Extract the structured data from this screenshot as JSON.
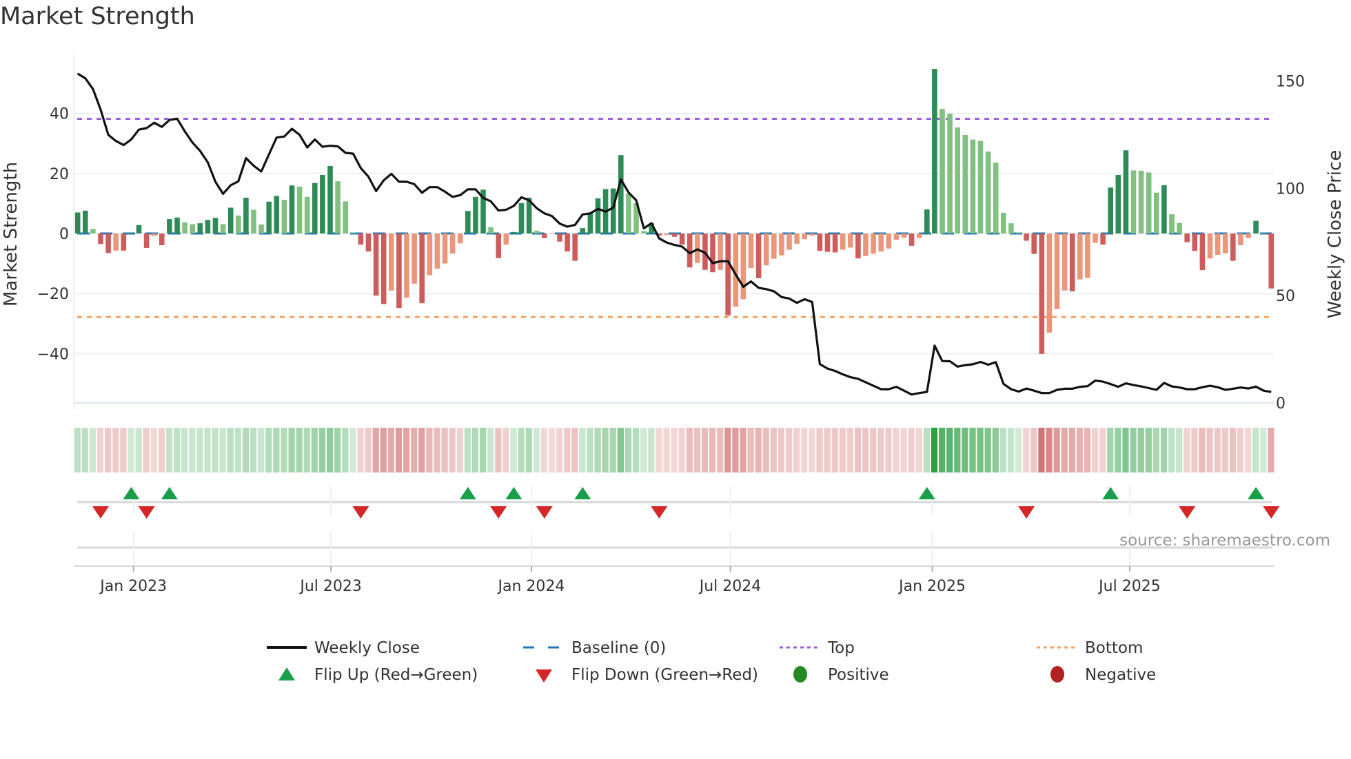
{
  "title": "Market Strength",
  "source": "source: sharemaestro.com",
  "colors": {
    "rise_green": "#2e8b57",
    "fall_green": "#81c07f",
    "fall_red": "#cd5c5c",
    "rise_red": "#e9967a",
    "close": "#111111",
    "baseline": "#1f77b4",
    "top": "#9b5fe0",
    "bottom": "#f4a261",
    "flip_up": "#1a9e4a",
    "flip_down": "#d62728",
    "positive": "#228b22",
    "negative": "#b22222"
  },
  "legend": {
    "weekly_close": "Weekly Close",
    "baseline": "Baseline (0)",
    "top": "Top",
    "bottom": "Bottom",
    "flip_up": "Flip Up (Red→Green)",
    "flip_down": "Flip Down (Green→Red)",
    "positive": "Positive",
    "negative": "Negative"
  },
  "chart_data": {
    "type": "bar",
    "title": "Market Strength",
    "ylabel": "Market Strength",
    "y2label": "Weekly Close Price",
    "x_unit": "week index",
    "ylim": [
      -57,
      59
    ],
    "y2lim": [
      0,
      160
    ],
    "yticks": [
      -40,
      -20,
      0,
      20,
      40
    ],
    "yticklabels": [
      "−40",
      "−20",
      "0",
      "20",
      "40"
    ],
    "y2ticks": [
      0,
      50,
      100,
      150
    ],
    "y2ticklabels": [
      "0",
      "50",
      "100",
      "150"
    ],
    "xticks": [
      7.3,
      33.1,
      59.3,
      85.3,
      111.7,
      137.5
    ],
    "xticklabels": [
      "Jan 2023",
      "Jul 2023",
      "Jan 2024",
      "Jul 2024",
      "Jan 2025",
      "Jul 2025"
    ],
    "top_level": 38.2,
    "bottom_level": -27.8,
    "baseline": 0,
    "strength": [
      7,
      7.6,
      1.5,
      -3.5,
      -6.5,
      -5.7,
      -5.7,
      0.3,
      2.8,
      -4.8,
      -0.8,
      -3.9,
      4.8,
      5.3,
      3.7,
      3.1,
      3.4,
      4.5,
      5.2,
      3.1,
      8.6,
      6,
      11.9,
      7.9,
      3,
      10.6,
      12.5,
      11.2,
      16,
      15.6,
      12.2,
      16.8,
      19.5,
      22.5,
      17.4,
      10.7,
      0.3,
      -3.7,
      -6,
      -20.7,
      -23.5,
      -19,
      -24.8,
      -21.4,
      -16.7,
      -23.2,
      -13.9,
      -11.7,
      -10,
      -6.7,
      -3.3,
      7.5,
      12.2,
      14.6,
      2.1,
      -8.2,
      -3.7,
      0.5,
      10.1,
      11.9,
      0.9,
      -1.5,
      -0.2,
      -2.7,
      -6,
      -9.1,
      1.8,
      6.7,
      11.7,
      14.8,
      15,
      26.1,
      13.3,
      10.1,
      0.8,
      3.4,
      -0.7,
      -0.5,
      -1.1,
      -3.7,
      -11.3,
      -9.8,
      -12.1,
      -12.9,
      -12.1,
      -27.3,
      -24.4,
      -21.9,
      -11.5,
      -14.9,
      -10.6,
      -8.4,
      -7.3,
      -5.4,
      -3.4,
      -1.9,
      -0.7,
      -5.8,
      -6.1,
      -6.3,
      -5.4,
      -4.7,
      -8.3,
      -7.5,
      -6.7,
      -6,
      -5,
      -2.1,
      -1.4,
      -4.1,
      -1.5,
      8,
      54.8,
      41.5,
      39.9,
      35.3,
      32.8,
      31.3,
      30.8,
      27.3,
      23.6,
      6.9,
      3.4,
      0.3,
      -2.4,
      -6.8,
      -40.1,
      -33,
      -25.2,
      -19,
      -19.3,
      -15.3,
      -14.8,
      -3.1,
      -3.7,
      15.3,
      19.5,
      27.7,
      21,
      20.9,
      20.3,
      13.6,
      16.1,
      6.4,
      3.5,
      -2.9,
      -5.8,
      -12.2,
      -8.3,
      -7.1,
      -6.6,
      -9.1,
      -3.9,
      -1.5,
      4.2,
      0.2,
      -18.3
    ],
    "weekly_close": [
      153.4,
      151.2,
      146.2,
      136.6,
      124.9,
      122,
      120.1,
      122.7,
      127.3,
      128,
      130.5,
      128.6,
      131.8,
      132.4,
      126.5,
      121.3,
      117.4,
      112.1,
      103,
      97.4,
      101.4,
      103.2,
      114,
      110.5,
      107.8,
      115.8,
      123.6,
      124.1,
      127.7,
      124.9,
      119,
      122.7,
      119.3,
      119.8,
      119.5,
      116.5,
      116.1,
      109.4,
      105.4,
      98.7,
      103.7,
      106.7,
      103,
      103,
      101.9,
      97.9,
      100.5,
      100.5,
      98.4,
      96,
      96.8,
      99.5,
      99.5,
      95.5,
      93.9,
      89.6,
      90,
      91.8,
      95.8,
      94.4,
      90.7,
      88.3,
      87,
      83.5,
      82.1,
      82.9,
      87.8,
      88.3,
      90.4,
      89.1,
      91,
      104.1,
      98,
      94.4,
      81.3,
      83.7,
      76.6,
      74.7,
      73.6,
      72.8,
      69.7,
      71.5,
      69.9,
      65.1,
      66,
      66,
      59.8,
      54.1,
      56.6,
      53.6,
      53,
      52,
      49.3,
      48.6,
      46.6,
      48.3,
      47,
      18.1,
      16,
      14.9,
      13.3,
      12,
      11.2,
      9.6,
      8,
      6.4,
      6.4,
      7.5,
      5.7,
      3.9,
      4.6,
      5.1,
      26.7,
      19.5,
      19.4,
      16.9,
      17.6,
      18,
      19.1,
      17.8,
      19,
      8.9,
      6.4,
      5.3,
      6.7,
      5.7,
      4.6,
      4.6,
      6.1,
      6.6,
      6.6,
      7.5,
      7.8,
      10.4,
      9.9,
      8.8,
      7.5,
      9.1,
      8.3,
      7.7,
      6.9,
      6.1,
      9.3,
      7.7,
      7.2,
      6.4,
      6.4,
      7.3,
      8,
      7.3,
      6.1,
      6.6,
      7.2,
      6.7,
      7.6,
      5.7,
      5.1
    ],
    "flip_up_weeks": [
      7,
      12,
      51,
      57,
      66,
      111,
      135,
      154
    ],
    "flip_down_weeks": [
      3,
      9,
      37,
      55,
      61,
      76,
      124,
      145,
      156
    ],
    "legend_position": "bottom"
  }
}
